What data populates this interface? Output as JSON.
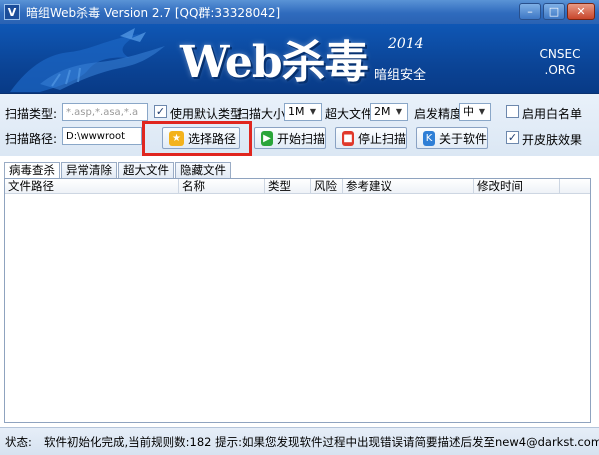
{
  "window": {
    "title": "暗组Web杀毒  Version 2.7  [QQ群:33328042]",
    "icon": "V",
    "minimize": "–",
    "maximize": "□",
    "close": "✕"
  },
  "banner": {
    "logo": "Web杀毒",
    "year": "2014",
    "slogan": "暗组安全",
    "site_line1": "CNSEC",
    "site_line2": ".ORG"
  },
  "scan": {
    "type_label": "扫描类型:",
    "type_value": "*.asp,*.asa,*.a",
    "use_default_label": "使用默认类型",
    "use_default_checked": true,
    "size_label": "扫描大小",
    "size_value": "1M",
    "bigfile_label": "超大文件",
    "bigfile_value": "2M",
    "precision_label": "启发精度",
    "precision_value": "中",
    "whitelist_label": "启用白名单",
    "whitelist_checked": false,
    "path_label": "扫描路径:",
    "path_value": "D:\\wwwroot",
    "skin_label": "开皮肤效果",
    "skin_checked": true
  },
  "buttons": {
    "choose_path": "选择路径",
    "start_scan": "开始扫描",
    "stop_scan": "停止扫描",
    "about": "关于软件"
  },
  "tabs": [
    "病毒查杀",
    "异常清除",
    "超大文件",
    "隐藏文件"
  ],
  "table": {
    "columns": [
      "文件路径",
      "名称",
      "类型",
      "风险",
      "参考建议",
      "修改时间"
    ],
    "rows": []
  },
  "status": {
    "label": "状态:",
    "text": "软件初始化完成,当前规则数:182 提示:如果您发现软件过程中出现错误请简要描述后发至new4@darkst.com"
  },
  "colors": {
    "banner": "#0b4496",
    "highlight": "#e0261f",
    "titlebar": "#2f6bbd"
  }
}
